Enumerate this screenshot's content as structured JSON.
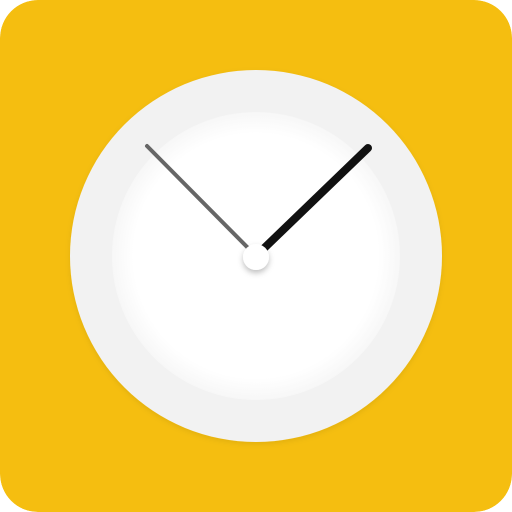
{
  "app_icon": {
    "icon": "clock-icon",
    "colors": {
      "background": "#F5BE10",
      "outer_face": "#F2F2F2",
      "inner_face": "#FFFFFF",
      "minute_hand": "#111111",
      "hour_hand": "#666666",
      "center_cap": "#FFFFFF"
    }
  }
}
